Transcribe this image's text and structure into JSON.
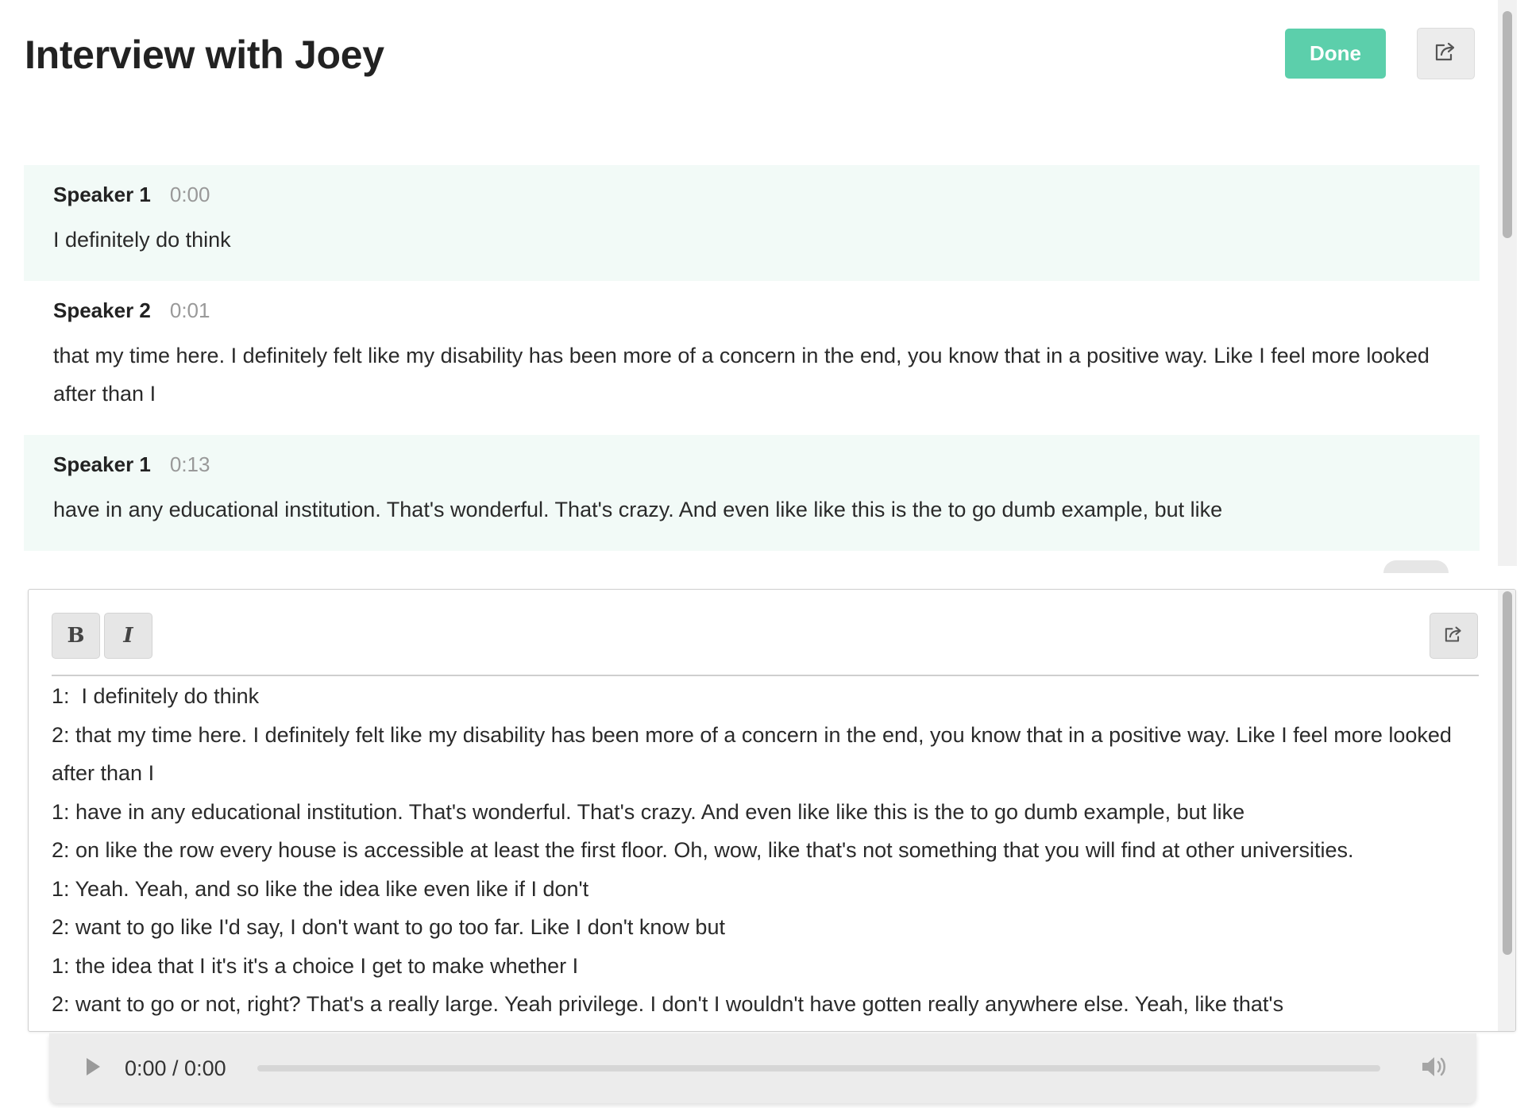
{
  "header": {
    "title": "Interview with Joey",
    "done_label": "Done",
    "share_icon": "share-icon"
  },
  "transcript": {
    "segments": [
      {
        "speaker": "Speaker 1",
        "time": "0:00",
        "text": "I definitely do think"
      },
      {
        "speaker": "Speaker 2",
        "time": "0:01",
        "text": "that my time here. I definitely felt like my disability has been more of a concern in the end, you know that in a positive way. Like I feel more looked after than I"
      },
      {
        "speaker": "Speaker 1",
        "time": "0:13",
        "text": "have in any educational institution. That's wonderful. That's crazy. And even like like this is the to go dumb example, but like"
      }
    ]
  },
  "editor": {
    "bold_label": "B",
    "italic_label": "I",
    "lines": [
      "1:  I definitely do think",
      "2: that my time here. I definitely felt like my disability has been more of a concern in the end, you know that in a positive way. Like I feel more looked after than I",
      "1: have in any educational institution. That's wonderful. That's crazy. And even like like this is the to go dumb example, but like",
      "2: on like the row every house is accessible at least the first floor. Oh, wow, like that's not something that you will find at other universities.",
      "1: Yeah. Yeah, and so like the idea like even like if I don't",
      "2: want to go like I'd say, I don't want to go too far. Like I don't know but",
      "1: the idea that I it's it's a choice I get to make whether I",
      "2: want to go or not, right? That's a really large. Yeah privilege. I don't I wouldn't have gotten really anywhere else. Yeah, like that's"
    ]
  },
  "audio": {
    "time_display": "0:00 / 0:00",
    "progress": 0,
    "play_icon": "play-icon",
    "volume_icon": "volume-icon"
  },
  "colors": {
    "accent": "#5ccfab",
    "alt_row": "#f2faf7",
    "button_gray": "#e6e6e6"
  }
}
